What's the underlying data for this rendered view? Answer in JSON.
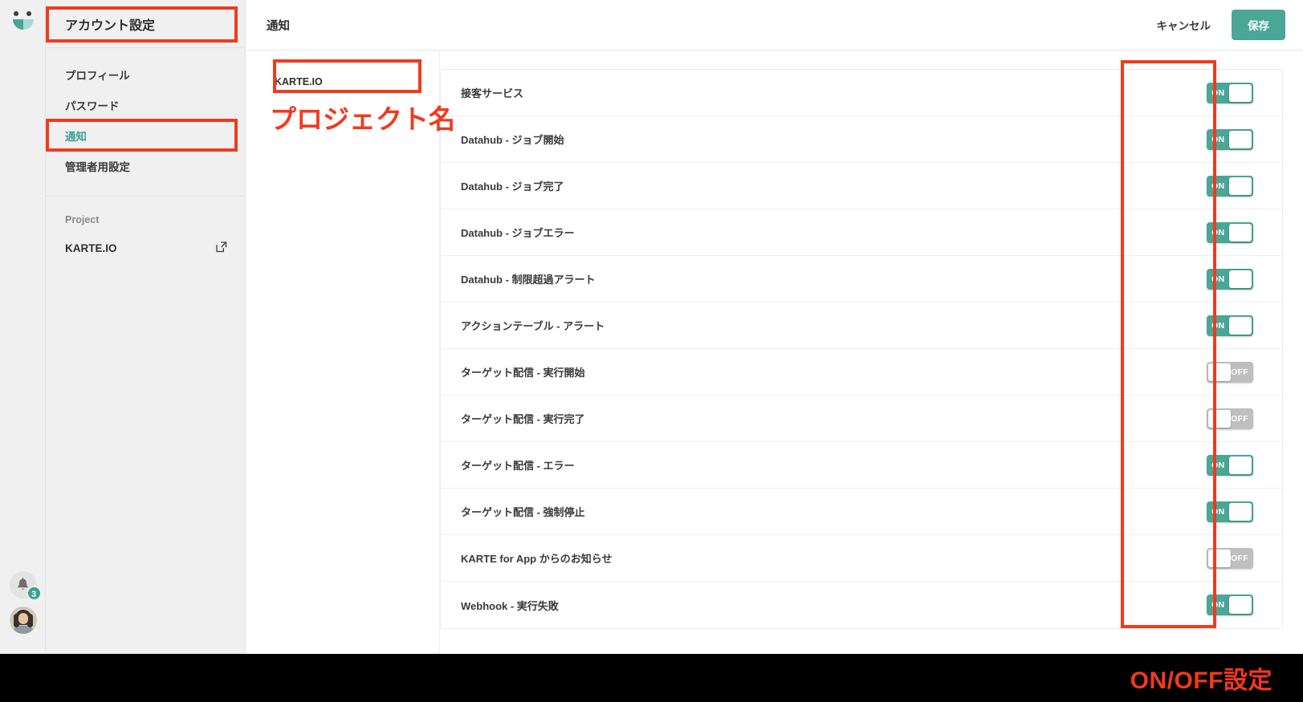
{
  "brand": {
    "logo_name": "karte-logo",
    "accent_teal": "#4aa697",
    "annotation_red": "#ef3b1c"
  },
  "rail": {
    "notifications_badge": "3",
    "bell_icon": "bell-icon",
    "avatar_alt": "user-avatar"
  },
  "sidebar": {
    "title": "アカウント設定",
    "items": [
      {
        "label": "プロフィール",
        "active": false
      },
      {
        "label": "パスワード",
        "active": false
      },
      {
        "label": "通知",
        "active": true
      },
      {
        "label": "管理者用設定",
        "active": false
      }
    ],
    "group_label": "Project",
    "project": {
      "name": "KARTE.IO",
      "external_icon": "external-link-icon"
    }
  },
  "header": {
    "title": "通知",
    "cancel_label": "キャンセル",
    "save_label": "保存"
  },
  "project_column": {
    "items": [
      {
        "label": "KARTE.IO",
        "selected": true
      }
    ]
  },
  "notifications": {
    "rows": [
      {
        "label": "接客サービス",
        "state": "ON"
      },
      {
        "label": "Datahub - ジョブ開始",
        "state": "ON"
      },
      {
        "label": "Datahub - ジョブ完了",
        "state": "ON"
      },
      {
        "label": "Datahub - ジョブエラー",
        "state": "ON"
      },
      {
        "label": "Datahub - 制限超過アラート",
        "state": "ON"
      },
      {
        "label": "アクションテーブル - アラート",
        "state": "ON"
      },
      {
        "label": "ターゲット配信 - 実行開始",
        "state": "OFF"
      },
      {
        "label": "ターゲット配信 - 実行完了",
        "state": "OFF"
      },
      {
        "label": "ターゲット配信 - エラー",
        "state": "ON"
      },
      {
        "label": "ターゲット配信 - 強制停止",
        "state": "ON"
      },
      {
        "label": "KARTE for App からのお知らせ",
        "state": "OFF"
      },
      {
        "label": "Webhook - 実行失敗",
        "state": "ON"
      }
    ]
  },
  "annotations": {
    "project_name_caption": "プロジェクト名",
    "onoff_caption": "ON/OFF設定"
  }
}
